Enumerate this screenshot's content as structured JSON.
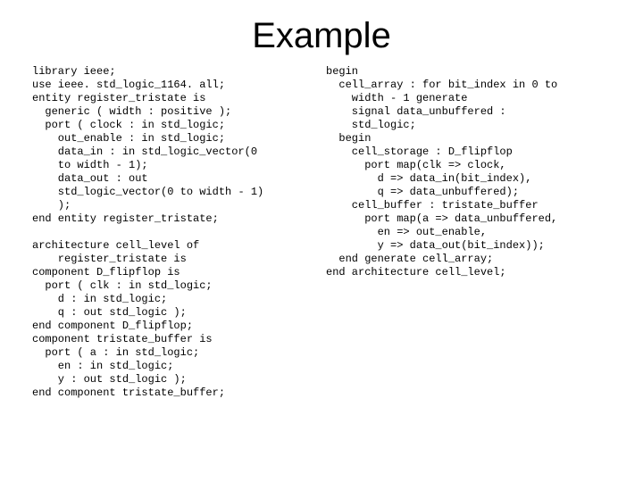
{
  "title": "Example",
  "left_code": "library ieee;\nuse ieee. std_logic_1164. all;\nentity register_tristate is\n  generic ( width : positive );\n  port ( clock : in std_logic;\n    out_enable : in std_logic;\n    data_in : in std_logic_vector(0\n    to width - 1);\n    data_out : out\n    std_logic_vector(0 to width - 1)\n    );\nend entity register_tristate;\n\narchitecture cell_level of\n    register_tristate is\ncomponent D_flipflop is\n  port ( clk : in std_logic;\n    d : in std_logic;\n    q : out std_logic );\nend component D_flipflop;\ncomponent tristate_buffer is\n  port ( a : in std_logic;\n    en : in std_logic;\n    y : out std_logic );\nend component tristate_buffer;",
  "right_code": "begin\n  cell_array : for bit_index in 0 to\n    width - 1 generate\n    signal data_unbuffered :\n    std_logic;\n  begin\n    cell_storage : D_flipflop\n      port map(clk => clock,\n        d => data_in(bit_index),\n        q => data_unbuffered);\n    cell_buffer : tristate_buffer\n      port map(a => data_unbuffered,\n        en => out_enable,\n        y => data_out(bit_index));\n  end generate cell_array;\nend architecture cell_level;"
}
